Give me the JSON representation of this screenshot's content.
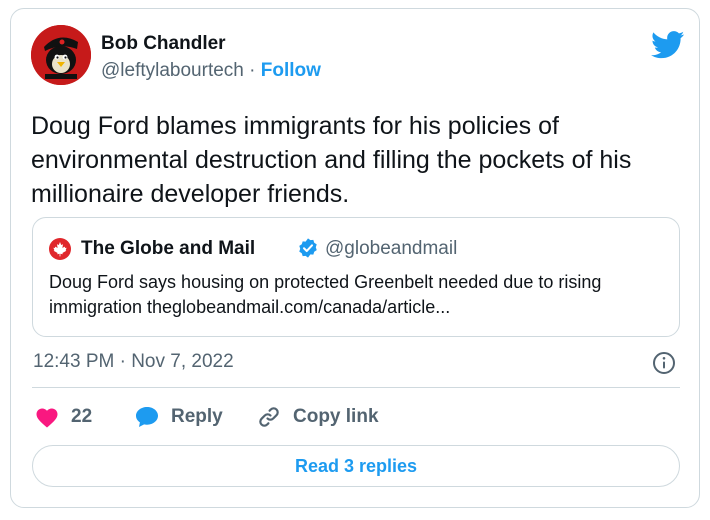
{
  "tweet": {
    "author_name": "Bob Chandler",
    "author_handle": "@leftylabourtech",
    "separator": "·",
    "follow_label": "Follow",
    "text": "Doug Ford blames immigrants for his policies of environmental destruction and filling the pockets of his millionaire developer friends.",
    "timestamp": "12:43 PM · Nov 7, 2022"
  },
  "quote": {
    "author_name": "The Globe and Mail",
    "author_handle": "@globeandmail",
    "text": "Doug Ford says housing on protected Greenbelt needed due to rising immigration theglobeandmail.com/canada/article..."
  },
  "actions": {
    "like_count": "22",
    "reply_label": "Reply",
    "copy_link_label": "Copy link"
  },
  "read_replies_label": "Read 3 replies",
  "icons": {
    "brand": "twitter-bird-icon",
    "like": "heart-icon",
    "reply": "speech-bubble-icon",
    "copy": "link-icon",
    "info": "info-icon",
    "verified": "verified-badge-icon",
    "quote_avatar": "maple-leaf-icon"
  },
  "colors": {
    "accent": "#1d9bf0",
    "like": "#f91880",
    "text": "#0f1419",
    "muted": "#536471",
    "border": "#cfd9de",
    "avatar_bg": "#c61a1a"
  }
}
